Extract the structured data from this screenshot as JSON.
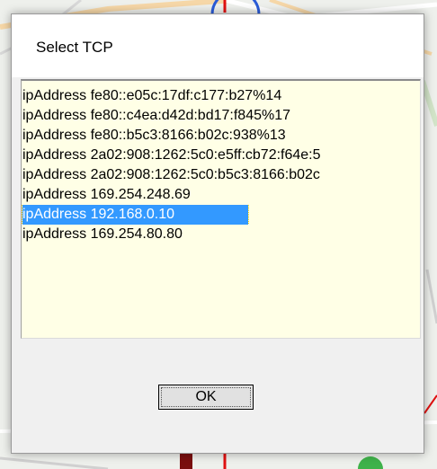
{
  "dialog": {
    "title": "Select TCP",
    "ok_label": "OK"
  },
  "list": {
    "selected_index": 6,
    "items": [
      {
        "label": "ipAddress fe80::e05c:17df:c177:b27%14"
      },
      {
        "label": "ipAddress fe80::c4ea:d42d:bd17:f845%17"
      },
      {
        "label": "ipAddress fe80::b5c3:8166:b02c:938%13"
      },
      {
        "label": "ipAddress 2a02:908:1262:5c0:e5ff:cb72:f64e:5"
      },
      {
        "label": "ipAddress 2a02:908:1262:5c0:b5c3:8166:b02c"
      },
      {
        "label": "ipAddress 169.254.248.69"
      },
      {
        "label": "ipAddress 192.168.0.10"
      },
      {
        "label": "ipAddress 169.254.80.80"
      }
    ]
  },
  "colors": {
    "list_background": "#ffffe6",
    "selection_background": "#3399ff",
    "selection_text": "#ffffff",
    "dialog_background": "#f0f0f0"
  }
}
